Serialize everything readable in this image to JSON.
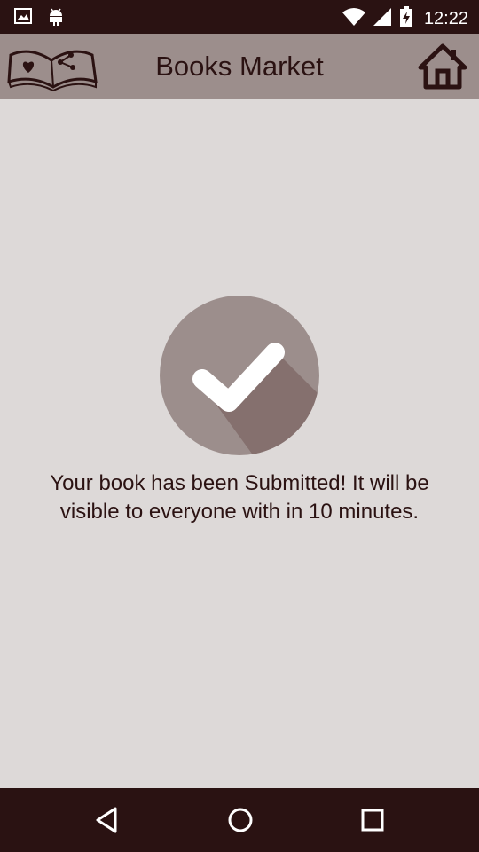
{
  "status_bar": {
    "time": "12:22",
    "left_icons": [
      "image-icon",
      "android-icon"
    ],
    "right_icons": [
      "wifi-icon",
      "signal-icon",
      "battery-charging-icon"
    ]
  },
  "app_bar": {
    "title": "Books Market",
    "logo_icon": "open-book-icon",
    "home_icon": "home-icon"
  },
  "main": {
    "status_icon": "check-circle-icon",
    "message": "Your book has been Submitted! It will be visible to everyone with in 10 minutes."
  },
  "nav_bar": {
    "buttons": [
      "back-icon",
      "home-circle-icon",
      "recents-icon"
    ]
  },
  "colors": {
    "status_bar": "#2a1212",
    "app_bar": "#9c8e8c",
    "background": "#ddd9d8",
    "check_circle": "#9c8e8c",
    "text": "#2b1212"
  }
}
